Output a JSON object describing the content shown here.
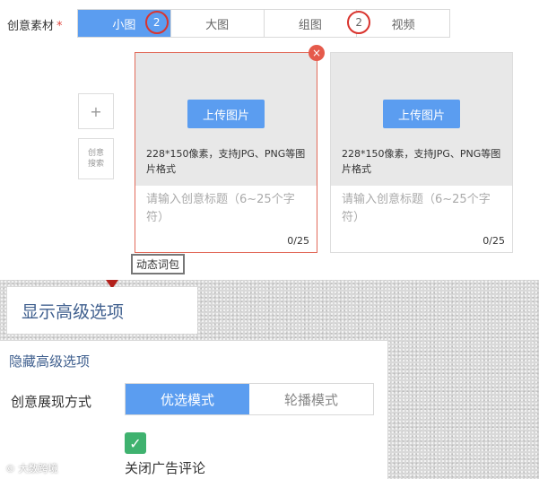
{
  "form": {
    "label": "创意素材",
    "required_mark": "*",
    "tabs": [
      {
        "label": "小图",
        "badge": "2",
        "active": true
      },
      {
        "label": "大图",
        "active": false
      },
      {
        "label": "组图",
        "badge": "2",
        "active": false
      },
      {
        "label": "视频",
        "active": false
      }
    ],
    "side": {
      "add_label": "+",
      "search_label": "创意\n搜索"
    },
    "cards": [
      {
        "upload_label": "上传图片",
        "spec": "228*150像素，支持JPG、PNG等图片格式",
        "title_placeholder": "请输入创意标题（6~25个字符）",
        "count": "0/25"
      },
      {
        "upload_label": "上传图片",
        "spec": "228*150像素，支持JPG、PNG等图片格式",
        "title_placeholder": "请输入创意标题（6~25个字符）",
        "count": "0/25"
      }
    ],
    "close_glyph": "×",
    "dynamic_words": "动态词包"
  },
  "advanced": {
    "show_label": "显示高级选项",
    "hide_label": "隐藏高级选项",
    "mode_label": "创意展现方式",
    "modes": [
      {
        "label": "优选模式",
        "active": true
      },
      {
        "label": "轮播模式",
        "active": false
      }
    ],
    "check_glyph": "✓",
    "close_comments_label": "关闭广告评论"
  },
  "watermark": "大数跨境",
  "colors": {
    "accent": "#5b9df0",
    "danger": "#d9342e",
    "success": "#3fb26f",
    "link": "#3f5f8e"
  }
}
